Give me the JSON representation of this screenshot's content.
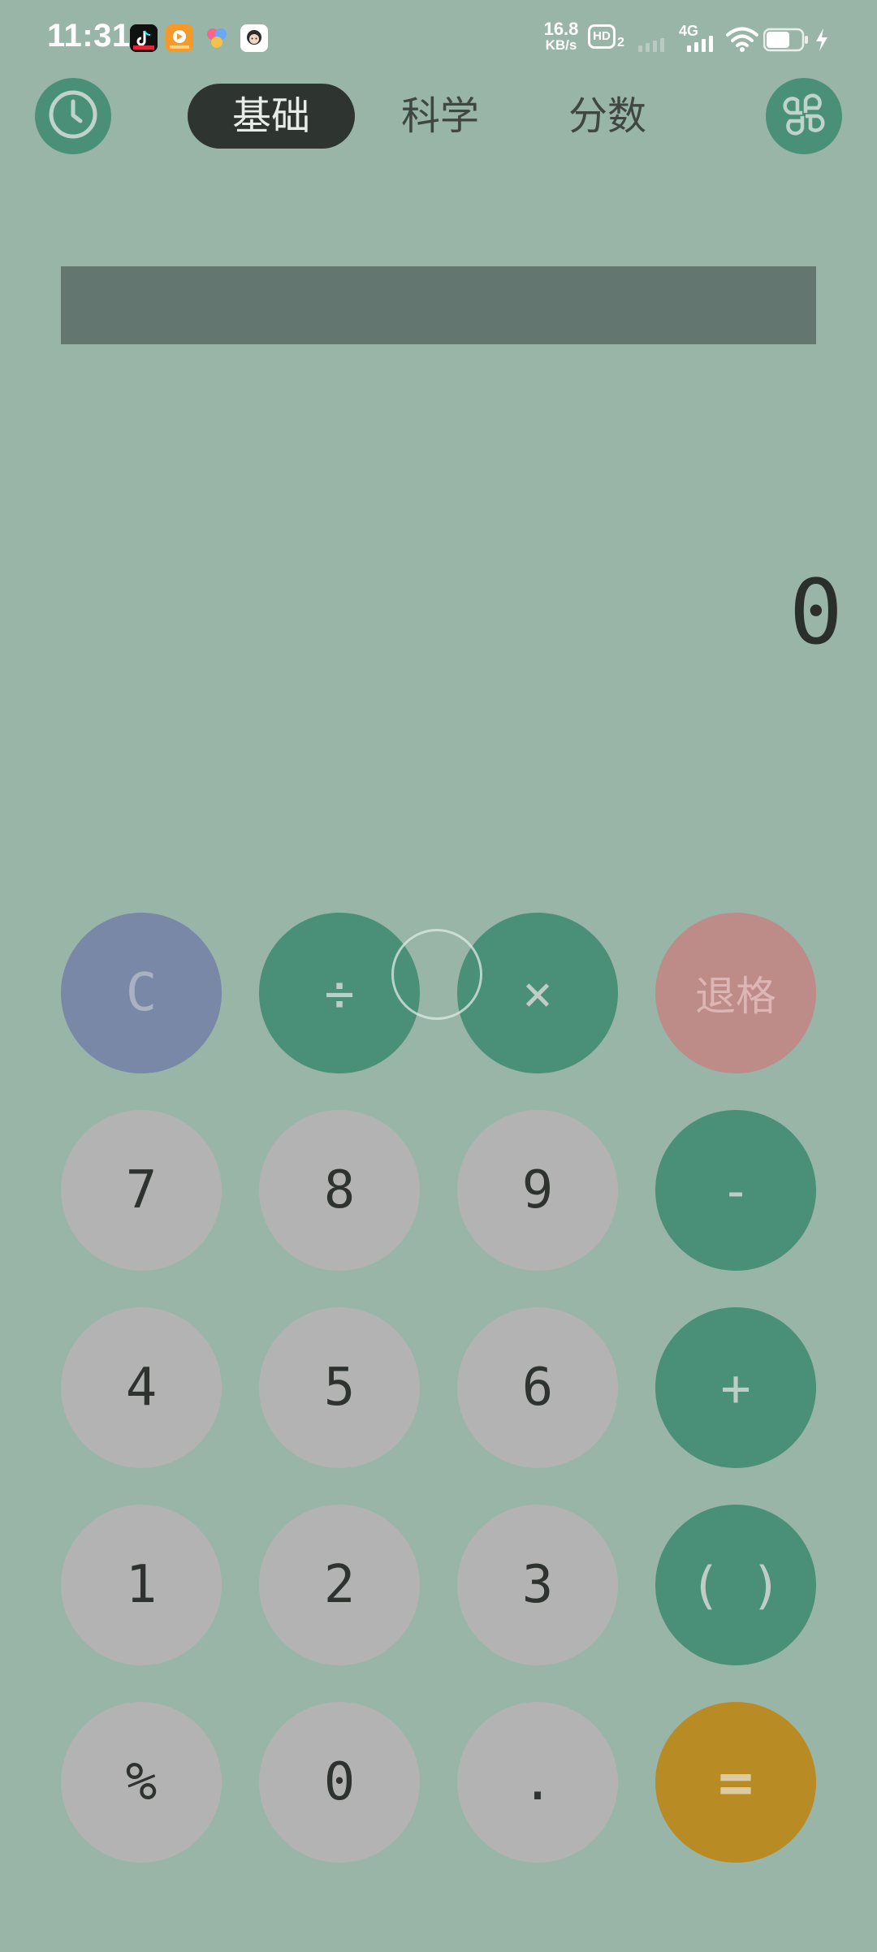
{
  "status_bar": {
    "time": "11:31",
    "net_speed_value": "16.8",
    "net_speed_unit": "KB/s",
    "hd_label": "HD",
    "hd_sub": "2",
    "network_label": "4G",
    "icons": [
      "tiktok-icon",
      "video-app-icon",
      "browser-app-icon",
      "avatar-app-icon",
      "signal-icon",
      "wifi-icon",
      "battery-icon",
      "charging-icon"
    ]
  },
  "header": {
    "history_icon": "clock-icon",
    "menu_icon": "four-petal-icon",
    "tabs": [
      {
        "label": "基础",
        "active": true
      },
      {
        "label": "科学",
        "active": false
      },
      {
        "label": "分数",
        "active": false
      }
    ]
  },
  "display": {
    "expression": "",
    "result": "0"
  },
  "keypad": {
    "row1": [
      "C",
      "÷",
      "×",
      "退格"
    ],
    "row2": [
      "7",
      "8",
      "9",
      "-"
    ],
    "row3": [
      "4",
      "5",
      "6",
      "+"
    ],
    "row4": [
      "1",
      "2",
      "3",
      "( )"
    ],
    "row5": [
      "%",
      "0",
      ".",
      "="
    ]
  },
  "colors": {
    "background": "#98b5a8",
    "accent_green": "#4a9079",
    "number_key": "#b3b3b3",
    "clear_key": "#7888a6",
    "backspace_key": "#bd8c89",
    "equals_key": "#b88b25",
    "active_tab": "#2e3531",
    "expression_bar": "#637670"
  }
}
